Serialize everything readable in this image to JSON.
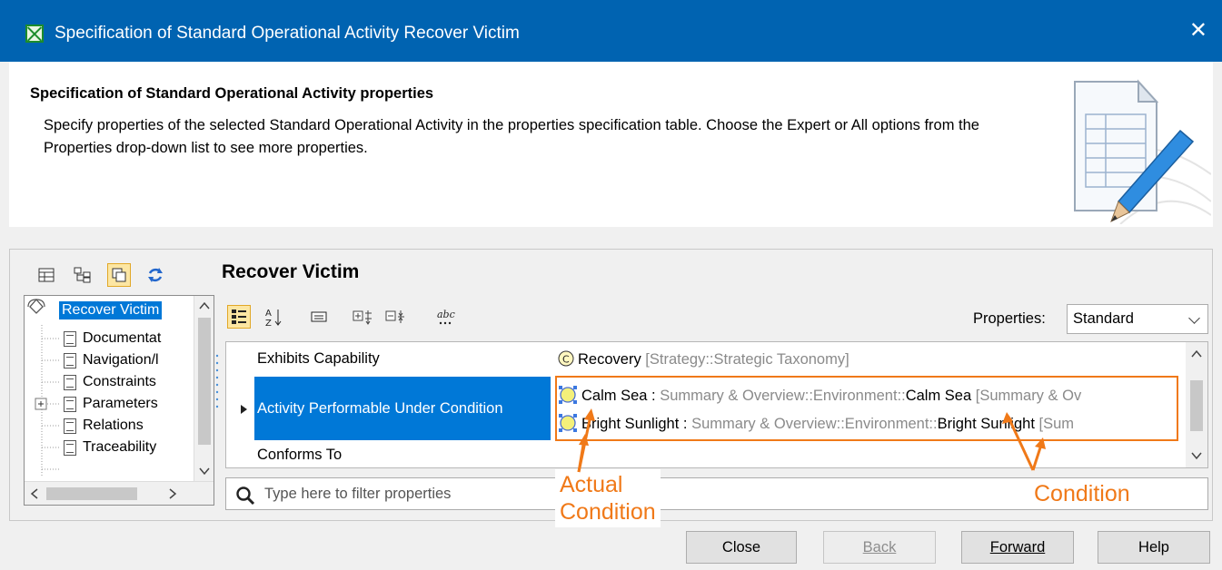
{
  "window": {
    "title": "Specification of Standard Operational Activity Recover Victim",
    "close_glyph": "✕"
  },
  "header": {
    "title": "Specification of Standard Operational Activity properties",
    "description": "Specify properties of the selected Standard Operational Activity in the properties specification table. Choose the Expert or All options from the Properties drop-down list to see more properties."
  },
  "element_title": "Recover Victim",
  "tree": {
    "items": [
      {
        "label": "Recover Victim",
        "selected": true
      },
      {
        "label": "Documentat"
      },
      {
        "label": "Navigation/l"
      },
      {
        "label": "Constraints"
      },
      {
        "label": "Parameters",
        "expandable": true
      },
      {
        "label": "Relations"
      },
      {
        "label": "Traceability"
      }
    ]
  },
  "properties": {
    "label": "Properties:",
    "selected": "Standard"
  },
  "table": {
    "rows": [
      {
        "name": "Exhibits Capability",
        "value_main": "Recovery",
        "value_muted": " [Strategy::Strategic Taxonomy]"
      },
      {
        "name": "Activity Performable Under Condition",
        "selected": true,
        "values": [
          {
            "a": "Calm Sea",
            "b": " : ",
            "c": "Summary & Overview::Environment::",
            "d": "Calm Sea",
            "e": " [Summary & Ov"
          },
          {
            "a": "Bright Sunlight",
            "b": " : ",
            "c": "Summary & Overview::Environment::",
            "d": "Bright Sunlight",
            "e": " [Sum"
          }
        ]
      },
      {
        "name": "Conforms To"
      }
    ]
  },
  "filter": {
    "placeholder": "Type here to filter properties"
  },
  "callouts": {
    "actual": [
      "Actual",
      "Condition"
    ],
    "condition": "Condition"
  },
  "buttons": {
    "close": "Close",
    "back": "Back",
    "forward": "Forward",
    "help": "Help"
  },
  "colors": {
    "titlebar": "#0063b1",
    "selection": "#0078d7",
    "annotation": "#f07918"
  }
}
